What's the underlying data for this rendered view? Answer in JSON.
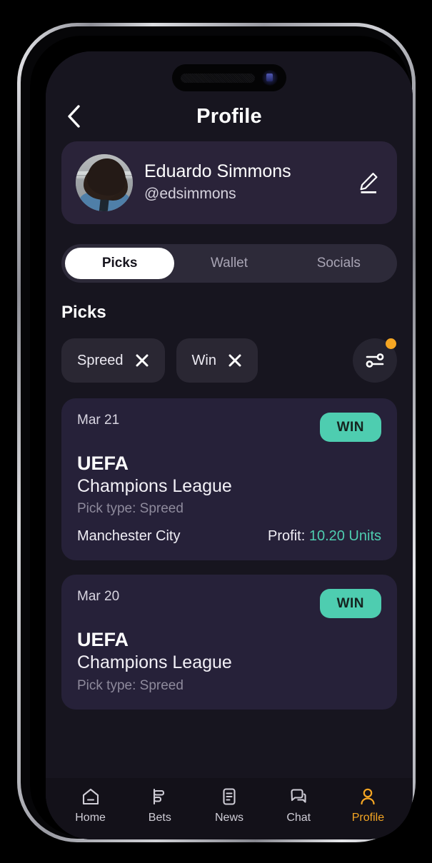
{
  "header": {
    "title": "Profile",
    "back_icon": "chevron-left-icon"
  },
  "profile": {
    "name": "Eduardo Simmons",
    "handle": "@edsimmons",
    "edit_icon": "pencil-edit-icon",
    "avatar_alt": "user-avatar"
  },
  "tabs": [
    {
      "label": "Picks",
      "active": true
    },
    {
      "label": "Wallet",
      "active": false
    },
    {
      "label": "Socials",
      "active": false
    }
  ],
  "section": {
    "title": "Picks"
  },
  "filters": {
    "chips": [
      {
        "label": "Spreed",
        "remove_icon": "close-icon"
      },
      {
        "label": "Win",
        "remove_icon": "close-icon"
      }
    ],
    "filter_button_icon": "sliders-icon",
    "has_notification": true,
    "notification_color": "#f5a623"
  },
  "picks": [
    {
      "date": "Mar 21",
      "status": "WIN",
      "league_line1": "UEFA",
      "league_line2": "Champions League",
      "pick_type": "Pick type: Spreed",
      "team": "Manchester City",
      "profit_label": "Profit:",
      "profit_value": "10.20 Units"
    },
    {
      "date": "Mar 20",
      "status": "WIN",
      "league_line1": "UEFA",
      "league_line2": "Champions League",
      "pick_type": "Pick type: Spreed",
      "team": "",
      "profit_label": "",
      "profit_value": ""
    }
  ],
  "bottom_nav": [
    {
      "label": "Home",
      "icon": "home-icon",
      "active": false
    },
    {
      "label": "Bets",
      "icon": "bets-chart-icon",
      "active": false
    },
    {
      "label": "News",
      "icon": "news-document-icon",
      "active": false
    },
    {
      "label": "Chat",
      "icon": "chat-bubbles-icon",
      "active": false
    },
    {
      "label": "Profile",
      "icon": "person-icon",
      "active": true
    }
  ],
  "theme": {
    "page_bg": "#17151f",
    "card_bg": "#262139",
    "profile_card_bg": "#2a2339",
    "accent_green": "#4ecdb0",
    "accent_orange": "#f5a623",
    "nav_bg": "#131119"
  }
}
